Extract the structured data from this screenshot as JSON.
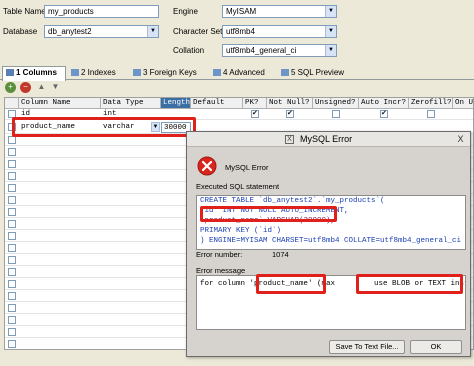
{
  "form": {
    "table_name_label": "Table Name",
    "table_name_value": "my_products",
    "engine_label": "Engine",
    "engine_value": "MyISAM",
    "database_label": "Database",
    "database_value": "db_anytest2",
    "charset_label": "Character Set",
    "charset_value": "utf8mb4",
    "collation_label": "Collation",
    "collation_value": "utf8mb4_general_ci"
  },
  "tabs": [
    {
      "label": "1 Columns"
    },
    {
      "label": "2 Indexes"
    },
    {
      "label": "3 Foreign Keys"
    },
    {
      "label": "4 Advanced"
    },
    {
      "label": "5 SQL Preview"
    }
  ],
  "toolbar": {
    "add": "+",
    "remove": "−"
  },
  "columns": [
    "Column Name",
    "Data Type",
    "Length",
    "Default",
    "PK?",
    "Not Null?",
    "Unsigned?",
    "Auto Incr?",
    "Zerofill?",
    "On Up"
  ],
  "rows": [
    {
      "name": "id",
      "type": "int",
      "length": "",
      "pk": true,
      "notnull": true,
      "unsigned": false,
      "autoincr": true
    },
    {
      "name": "product_name",
      "type": "varchar",
      "length": "30000",
      "pk": false,
      "notnull": false,
      "unsigned": false,
      "autoincr": false
    }
  ],
  "dialog": {
    "title": "MySQL Error",
    "close": "X",
    "error_heading": "MySQL Error",
    "executed_label": "Executed SQL statement",
    "sql_lines": [
      "CREATE TABLE `db_anytest2`.`my_products`(",
      "  `id` INT NOT NULL AUTO_INCREMENT,",
      "  `product_name` VARCHAR(30000),",
      "  PRIMARY KEY (`id`)",
      ") ENGINE=MYISAM CHARSET=utf8mb4 COLLATE=utf8mb4_general_ci"
    ],
    "error_number_label": "Error number:",
    "error_number": "1074",
    "error_message_label": "Error message",
    "error_message_start": "for column 'product_name' (max",
    "error_message_end": "use BLOB or TEXT instead",
    "save_button": "Save To Text File...",
    "ok_button": "OK"
  },
  "colors": {
    "highlight": "#e0201a",
    "header_selected": "#3a6ea5"
  }
}
